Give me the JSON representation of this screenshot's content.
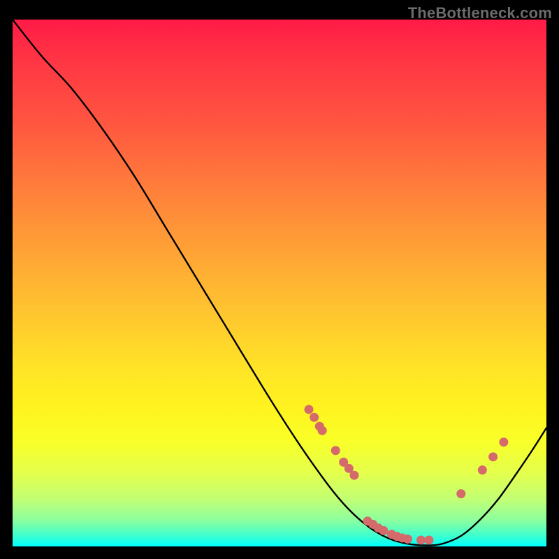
{
  "watermark": "TheBottleneck.com",
  "chart_data": {
    "type": "line",
    "title": "",
    "xlabel": "",
    "ylabel": "",
    "xlim": [
      0,
      1
    ],
    "ylim": [
      0,
      1
    ],
    "curve": [
      {
        "x": 0.0,
        "y": 1.0
      },
      {
        "x": 0.055,
        "y": 0.93
      },
      {
        "x": 0.11,
        "y": 0.87
      },
      {
        "x": 0.17,
        "y": 0.79
      },
      {
        "x": 0.23,
        "y": 0.7
      },
      {
        "x": 0.29,
        "y": 0.6
      },
      {
        "x": 0.35,
        "y": 0.5
      },
      {
        "x": 0.41,
        "y": 0.4
      },
      {
        "x": 0.47,
        "y": 0.3
      },
      {
        "x": 0.52,
        "y": 0.22
      },
      {
        "x": 0.56,
        "y": 0.16
      },
      {
        "x": 0.6,
        "y": 0.105
      },
      {
        "x": 0.635,
        "y": 0.065
      },
      {
        "x": 0.67,
        "y": 0.035
      },
      {
        "x": 0.705,
        "y": 0.015
      },
      {
        "x": 0.74,
        "y": 0.005
      },
      {
        "x": 0.775,
        "y": 0.002
      },
      {
        "x": 0.805,
        "y": 0.005
      },
      {
        "x": 0.84,
        "y": 0.02
      },
      {
        "x": 0.875,
        "y": 0.05
      },
      {
        "x": 0.91,
        "y": 0.09
      },
      {
        "x": 0.945,
        "y": 0.14
      },
      {
        "x": 0.975,
        "y": 0.185
      },
      {
        "x": 1.0,
        "y": 0.225
      }
    ],
    "dots": [
      {
        "x": 0.555,
        "y": 0.26
      },
      {
        "x": 0.565,
        "y": 0.245
      },
      {
        "x": 0.575,
        "y": 0.228
      },
      {
        "x": 0.58,
        "y": 0.22
      },
      {
        "x": 0.605,
        "y": 0.182
      },
      {
        "x": 0.62,
        "y": 0.16
      },
      {
        "x": 0.63,
        "y": 0.148
      },
      {
        "x": 0.64,
        "y": 0.135
      },
      {
        "x": 0.665,
        "y": 0.048
      },
      {
        "x": 0.675,
        "y": 0.042
      },
      {
        "x": 0.685,
        "y": 0.035
      },
      {
        "x": 0.695,
        "y": 0.03
      },
      {
        "x": 0.71,
        "y": 0.023
      },
      {
        "x": 0.72,
        "y": 0.019
      },
      {
        "x": 0.73,
        "y": 0.016
      },
      {
        "x": 0.74,
        "y": 0.014
      },
      {
        "x": 0.765,
        "y": 0.012
      },
      {
        "x": 0.78,
        "y": 0.012
      },
      {
        "x": 0.84,
        "y": 0.1
      },
      {
        "x": 0.88,
        "y": 0.145
      },
      {
        "x": 0.9,
        "y": 0.17
      },
      {
        "x": 0.92,
        "y": 0.198
      }
    ],
    "dots_cluster_near_minimum_x": {
      "start": 0.63,
      "end": 0.8
    }
  }
}
